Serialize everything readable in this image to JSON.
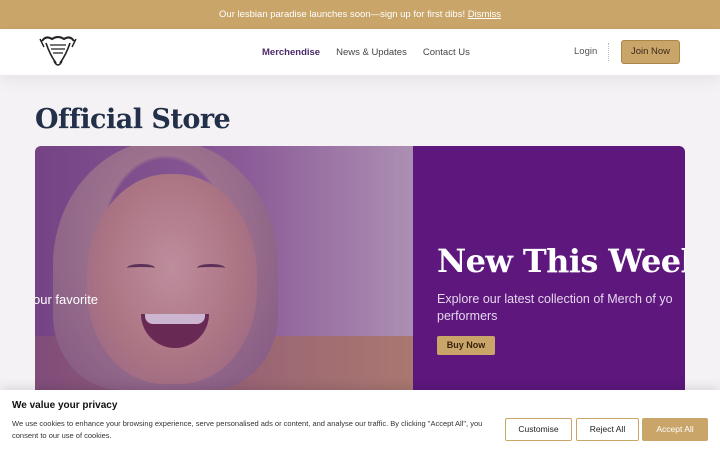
{
  "announcement": {
    "text": "Our lesbian paradise launches soon—sign up for first dibs!",
    "dismiss_label": "Dismiss"
  },
  "nav": {
    "items": [
      {
        "label": "Merchendise",
        "active": true
      },
      {
        "label": "News & Updates",
        "active": false
      },
      {
        "label": "Contact Us",
        "active": false
      }
    ],
    "login_label": "Login",
    "join_label": "Join Now"
  },
  "page": {
    "title": "Official Store"
  },
  "hero": {
    "photo_caption": "our favorite",
    "heading": "New This Week",
    "text_line1": "Explore our latest collection of Merch of yo",
    "text_line2": "performers",
    "button_label": "Buy Now",
    "panel_color": "#5d177d"
  },
  "cookie": {
    "title": "We value your privacy",
    "text": "We use cookies to enhance your browsing experience, serve personalised ads or content, and analyse our traffic. By clicking \"Accept All\", you consent to our use of cookies.",
    "customise_label": "Customise",
    "reject_label": "Reject All",
    "accept_label": "Accept All"
  },
  "colors": {
    "accent": "#c9a56a",
    "brand_purple": "#5d177d",
    "title_navy": "#23304a"
  }
}
